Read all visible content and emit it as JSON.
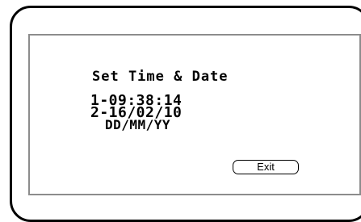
{
  "screen": {
    "title": "Set Time & Date",
    "time_line": "1-09:38:14",
    "date_line": "2-16/02/10",
    "date_format": "DD/MM/YY"
  },
  "buttons": {
    "exit_label": "Exit"
  },
  "colors": {
    "frame": "#000000",
    "screen_border": "#8c8c8c",
    "background": "#ffffff",
    "text": "#000000"
  }
}
